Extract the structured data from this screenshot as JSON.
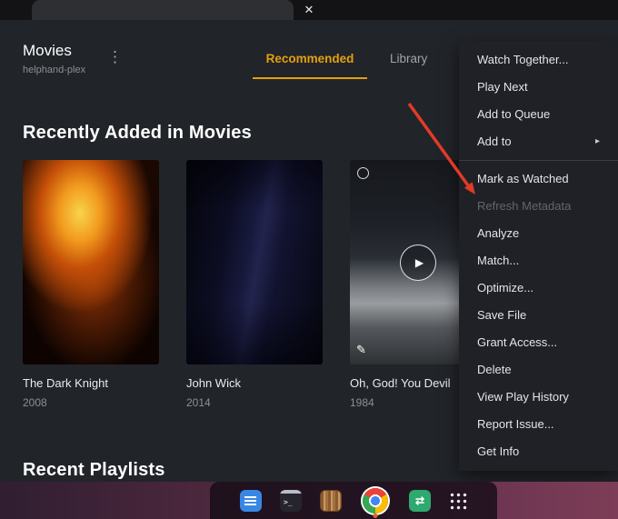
{
  "topbar": {
    "close": "✕"
  },
  "header": {
    "title": "Movies",
    "server": "helphand-plex",
    "tabs": [
      {
        "label": "Recommended"
      },
      {
        "label": "Library"
      }
    ]
  },
  "sections": {
    "recently_added": "Recently Added in Movies",
    "recent_playlists": "Recent Playlists"
  },
  "movies": [
    {
      "title": "The Dark Knight",
      "year": "2008"
    },
    {
      "title": "John Wick",
      "year": "2014"
    },
    {
      "title": "Oh, God! You Devil",
      "year": "1984"
    }
  ],
  "context_menu": {
    "group1": [
      {
        "label": "Watch Together..."
      },
      {
        "label": "Play Next"
      },
      {
        "label": "Add to Queue"
      },
      {
        "label": "Add to",
        "submenu": "▸"
      }
    ],
    "group2": [
      {
        "label": "Mark as Watched"
      },
      {
        "label": "Refresh Metadata",
        "disabled": true
      },
      {
        "label": "Analyze"
      },
      {
        "label": "Match..."
      },
      {
        "label": "Optimize..."
      },
      {
        "label": "Save File"
      },
      {
        "label": "Grant Access..."
      },
      {
        "label": "Delete"
      },
      {
        "label": "View Play History"
      },
      {
        "label": "Report Issue..."
      },
      {
        "label": "Get Info"
      }
    ]
  },
  "icons": {
    "more": "⋮",
    "play": "▶",
    "edit": "✎",
    "terminal_glyph": ">_",
    "updater_glyph": "⇄"
  },
  "colors": {
    "accent": "#e5a00d",
    "arrow": "#e23a28"
  },
  "dock": {
    "icons": [
      "text-editor",
      "terminal",
      "documents",
      "chrome",
      "software-updater",
      "app-grid"
    ]
  }
}
